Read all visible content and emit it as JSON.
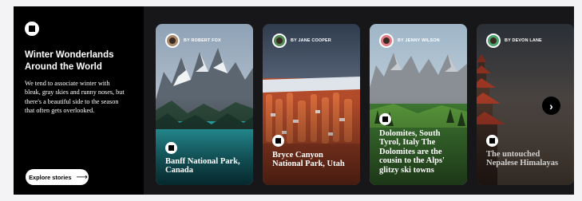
{
  "intro": {
    "logo_icon": "story-logo-icon",
    "title": "Winter Wonderlands Around the World",
    "description": "We tend to associate winter with bleak, gray skies and runny noses, but there's a beautiful side to the season that often gets overlooked.",
    "button_label": "Explore stories",
    "button_icon": "arrow-right-icon"
  },
  "cards": [
    {
      "author": "BY ROBERT FOX",
      "title": "Banff National Park, Canada",
      "avatar_color": "#a78a6e"
    },
    {
      "author": "BY JANE COOPER",
      "title": "Bryce Canyon National Park, Utah",
      "avatar_color": "#4f8a53"
    },
    {
      "author": "BY JENNY WILSON",
      "title": "Dolomites, South Tyrol, Italy The Dolomites are the cousin to the Alps' glitzy ski towns",
      "avatar_color": "#e07a86"
    },
    {
      "author": "BY DEVON LANE",
      "title": "The untouched Nepalese Himalayas",
      "avatar_color": "#4aa36b"
    }
  ],
  "carousel": {
    "next_icon": "chevron-right-icon"
  },
  "colors": {
    "background": "#f3f3f5",
    "panel": "#17171a",
    "intro_panel": "#000000"
  }
}
